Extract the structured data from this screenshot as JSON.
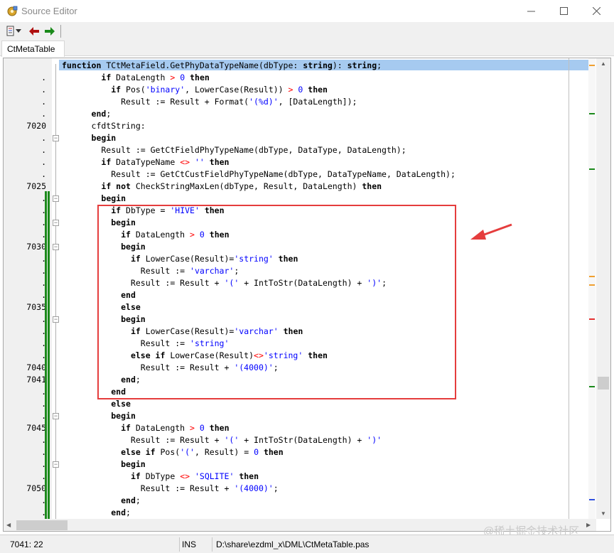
{
  "window": {
    "title": "Source Editor",
    "icons": {
      "app": "gear-puzzle-icon",
      "minimize": "minimize-icon",
      "maximize": "maximize-icon",
      "close": "close-icon"
    }
  },
  "toolbar": {
    "items": [
      {
        "name": "document-menu-button",
        "icon": "document-icon"
      },
      {
        "name": "back-button",
        "icon": "arrow-left-icon",
        "color": "#b01010"
      },
      {
        "name": "forward-button",
        "icon": "arrow-right-icon",
        "color": "#1a8a1a"
      }
    ]
  },
  "tabs": [
    {
      "label": "CtMetaTable",
      "active": true
    }
  ],
  "editor": {
    "line_numbers": [
      "",
      ".",
      ".",
      ".",
      ".",
      "7020",
      ".",
      ".",
      ".",
      ".",
      "7025",
      ".",
      ".",
      ".",
      ".",
      "7030",
      ".",
      ".",
      ".",
      ".",
      "7035",
      ".",
      ".",
      ".",
      ".",
      "7040",
      "7041",
      ".",
      ".",
      ".",
      "7045",
      ".",
      ".",
      ".",
      ".",
      "7050",
      ".",
      "."
    ],
    "code_lines": [
      [
        [
          "kw",
          "function "
        ],
        [
          "",
          "TCtMetaField.GetPhyDataTypeName(dbType: "
        ],
        [
          "kw",
          "string"
        ],
        [
          "",
          "): "
        ],
        [
          "kw",
          "string"
        ],
        [
          "",
          ";"
        ]
      ],
      [
        [
          "",
          "        "
        ],
        [
          "kw",
          "if "
        ],
        [
          "",
          "DataLength "
        ],
        [
          "sym",
          ">"
        ],
        [
          "",
          " "
        ],
        [
          "str",
          "0"
        ],
        [
          "",
          " "
        ],
        [
          "kw",
          "then"
        ]
      ],
      [
        [
          "",
          "          "
        ],
        [
          "kw",
          "if "
        ],
        [
          "",
          "Pos("
        ],
        [
          "str",
          "'binary'"
        ],
        [
          "",
          ", LowerCase(Result)) "
        ],
        [
          "sym",
          ">"
        ],
        [
          "",
          " "
        ],
        [
          "str",
          "0"
        ],
        [
          "",
          " "
        ],
        [
          "kw",
          "then"
        ]
      ],
      [
        [
          "",
          "            Result := Result + Format("
        ],
        [
          "str",
          "'(%d)'"
        ],
        [
          "",
          ", [DataLength]);"
        ]
      ],
      [
        [
          "",
          "      "
        ],
        [
          "kw",
          "end"
        ],
        [
          "",
          ";"
        ]
      ],
      [
        [
          "",
          "      cfdtString:"
        ]
      ],
      [
        [
          "",
          "      "
        ],
        [
          "kw",
          "begin"
        ]
      ],
      [
        [
          "",
          "        Result := GetCtFieldPhyTypeName(dbType, DataType, DataLength);"
        ]
      ],
      [
        [
          "",
          "        "
        ],
        [
          "kw",
          "if "
        ],
        [
          "",
          "DataTypeName "
        ],
        [
          "sym",
          "<>"
        ],
        [
          "",
          " "
        ],
        [
          "str",
          "''"
        ],
        [
          "",
          " "
        ],
        [
          "kw",
          "then"
        ]
      ],
      [
        [
          "",
          "          Result := GetCtCustFieldPhyTypeName(dbType, DataTypeName, DataLength);"
        ]
      ],
      [
        [
          "",
          "        "
        ],
        [
          "kw",
          "if not "
        ],
        [
          "",
          "CheckStringMaxLen(dbType, Result, DataLength) "
        ],
        [
          "kw",
          "then"
        ]
      ],
      [
        [
          "",
          "        "
        ],
        [
          "kw",
          "begin"
        ]
      ],
      [
        [
          "",
          "          "
        ],
        [
          "kw",
          "if "
        ],
        [
          "",
          "DbType = "
        ],
        [
          "str",
          "'HIVE'"
        ],
        [
          "",
          " "
        ],
        [
          "kw",
          "then"
        ]
      ],
      [
        [
          "",
          "          "
        ],
        [
          "kw",
          "begin"
        ]
      ],
      [
        [
          "",
          "            "
        ],
        [
          "kw",
          "if "
        ],
        [
          "",
          "DataLength "
        ],
        [
          "sym",
          ">"
        ],
        [
          "",
          " "
        ],
        [
          "str",
          "0"
        ],
        [
          "",
          " "
        ],
        [
          "kw",
          "then"
        ]
      ],
      [
        [
          "",
          "            "
        ],
        [
          "kw",
          "begin"
        ]
      ],
      [
        [
          "",
          "              "
        ],
        [
          "kw",
          "if "
        ],
        [
          "",
          "LowerCase(Result)="
        ],
        [
          "str",
          "'string'"
        ],
        [
          "",
          " "
        ],
        [
          "kw",
          "then"
        ]
      ],
      [
        [
          "",
          "                Result := "
        ],
        [
          "str",
          "'varchar'"
        ],
        [
          "",
          ";"
        ]
      ],
      [
        [
          "",
          "              Result := Result + "
        ],
        [
          "str",
          "'('"
        ],
        [
          "",
          " + IntToStr(DataLength) + "
        ],
        [
          "str",
          "')'"
        ],
        [
          "",
          ";"
        ]
      ],
      [
        [
          "",
          "            "
        ],
        [
          "kw",
          "end"
        ]
      ],
      [
        [
          "",
          "            "
        ],
        [
          "kw",
          "else"
        ]
      ],
      [
        [
          "",
          "            "
        ],
        [
          "kw",
          "begin"
        ]
      ],
      [
        [
          "",
          "              "
        ],
        [
          "kw",
          "if "
        ],
        [
          "",
          "LowerCase(Result)="
        ],
        [
          "str",
          "'varchar'"
        ],
        [
          "",
          " "
        ],
        [
          "kw",
          "then"
        ]
      ],
      [
        [
          "",
          "                Result := "
        ],
        [
          "str",
          "'string'"
        ]
      ],
      [
        [
          "",
          "              "
        ],
        [
          "kw",
          "else if "
        ],
        [
          "",
          "LowerCase(Result)"
        ],
        [
          "sym",
          "<>"
        ],
        [
          "str",
          "'string'"
        ],
        [
          "",
          " "
        ],
        [
          "kw",
          "then"
        ]
      ],
      [
        [
          "",
          "                Result := Result + "
        ],
        [
          "str",
          "'(4000)'"
        ],
        [
          "",
          ";"
        ]
      ],
      [
        [
          "",
          "            "
        ],
        [
          "kw",
          "end"
        ],
        [
          "",
          ";"
        ]
      ],
      [
        [
          "",
          "          "
        ],
        [
          "kw",
          "end"
        ]
      ],
      [
        [
          "",
          "          "
        ],
        [
          "kw",
          "else"
        ]
      ],
      [
        [
          "",
          "          "
        ],
        [
          "kw",
          "begin"
        ]
      ],
      [
        [
          "",
          "            "
        ],
        [
          "kw",
          "if "
        ],
        [
          "",
          "DataLength "
        ],
        [
          "sym",
          ">"
        ],
        [
          "",
          " "
        ],
        [
          "str",
          "0"
        ],
        [
          "",
          " "
        ],
        [
          "kw",
          "then"
        ]
      ],
      [
        [
          "",
          "              Result := Result + "
        ],
        [
          "str",
          "'('"
        ],
        [
          "",
          " + IntToStr(DataLength) + "
        ],
        [
          "str",
          "')'"
        ]
      ],
      [
        [
          "",
          "            "
        ],
        [
          "kw",
          "else if "
        ],
        [
          "",
          "Pos("
        ],
        [
          "str",
          "'('"
        ],
        [
          "",
          ", Result) = "
        ],
        [
          "str",
          "0"
        ],
        [
          "",
          " "
        ],
        [
          "kw",
          "then"
        ]
      ],
      [
        [
          "",
          "            "
        ],
        [
          "kw",
          "begin"
        ]
      ],
      [
        [
          "",
          "              "
        ],
        [
          "kw",
          "if "
        ],
        [
          "",
          "DbType "
        ],
        [
          "sym",
          "<>"
        ],
        [
          "",
          " "
        ],
        [
          "str",
          "'SQLITE'"
        ],
        [
          "",
          " "
        ],
        [
          "kw",
          "then"
        ]
      ],
      [
        [
          "",
          "                Result := Result + "
        ],
        [
          "str",
          "'(4000)'"
        ],
        [
          "",
          ";"
        ]
      ],
      [
        [
          "",
          "            "
        ],
        [
          "kw",
          "end"
        ],
        [
          "",
          ";"
        ]
      ],
      [
        [
          "",
          "          "
        ],
        [
          "kw",
          "end"
        ],
        [
          "",
          ";"
        ]
      ]
    ],
    "colors": {
      "keyword": "#000000",
      "string_literal": "#0000ff",
      "operator": "#ff0000",
      "current_line": "#a6caf0",
      "change_bar": "#1b8a1b"
    }
  },
  "status": {
    "position": "7041:  22",
    "mode": "INS",
    "file_path": "D:\\share\\ezdml_x\\DML\\CtMetaTable.pas"
  },
  "watermark": "@稀土掘金技术社区",
  "annotation": {
    "color": "#e53d3d",
    "icon": "arrow-pointer-icon"
  }
}
